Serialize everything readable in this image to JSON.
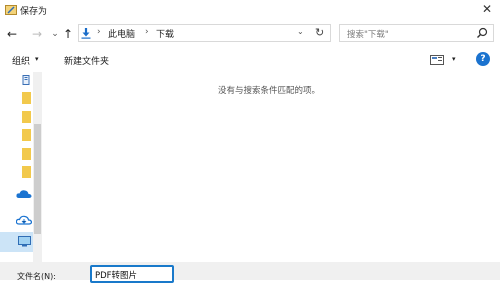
{
  "window": {
    "title": "保存为",
    "close": "✕"
  },
  "nav": {
    "back": "←",
    "forward": "→",
    "dropdown": "⌄",
    "up": "↑"
  },
  "address": {
    "sep1": "›",
    "pc": "此电脑",
    "sep2": "›",
    "folder": "下载",
    "chevron": "⌄",
    "refresh": "↻"
  },
  "search": {
    "placeholder": "搜索\"下载\""
  },
  "toolbar": {
    "organize": "组织",
    "organize_caret": "▾",
    "new_folder": "新建文件夹",
    "view_caret": "▾",
    "help": "?"
  },
  "content": {
    "empty_message": "没有与搜索条件匹配的项。"
  },
  "save": {
    "filename_label": "文件名(N):",
    "filename_value": "PDF转图片"
  },
  "colors": {
    "accent": "#1979ca",
    "folder": "#f2c94c",
    "onedrive": "#1a73d1",
    "selected": "#cce4f7"
  }
}
